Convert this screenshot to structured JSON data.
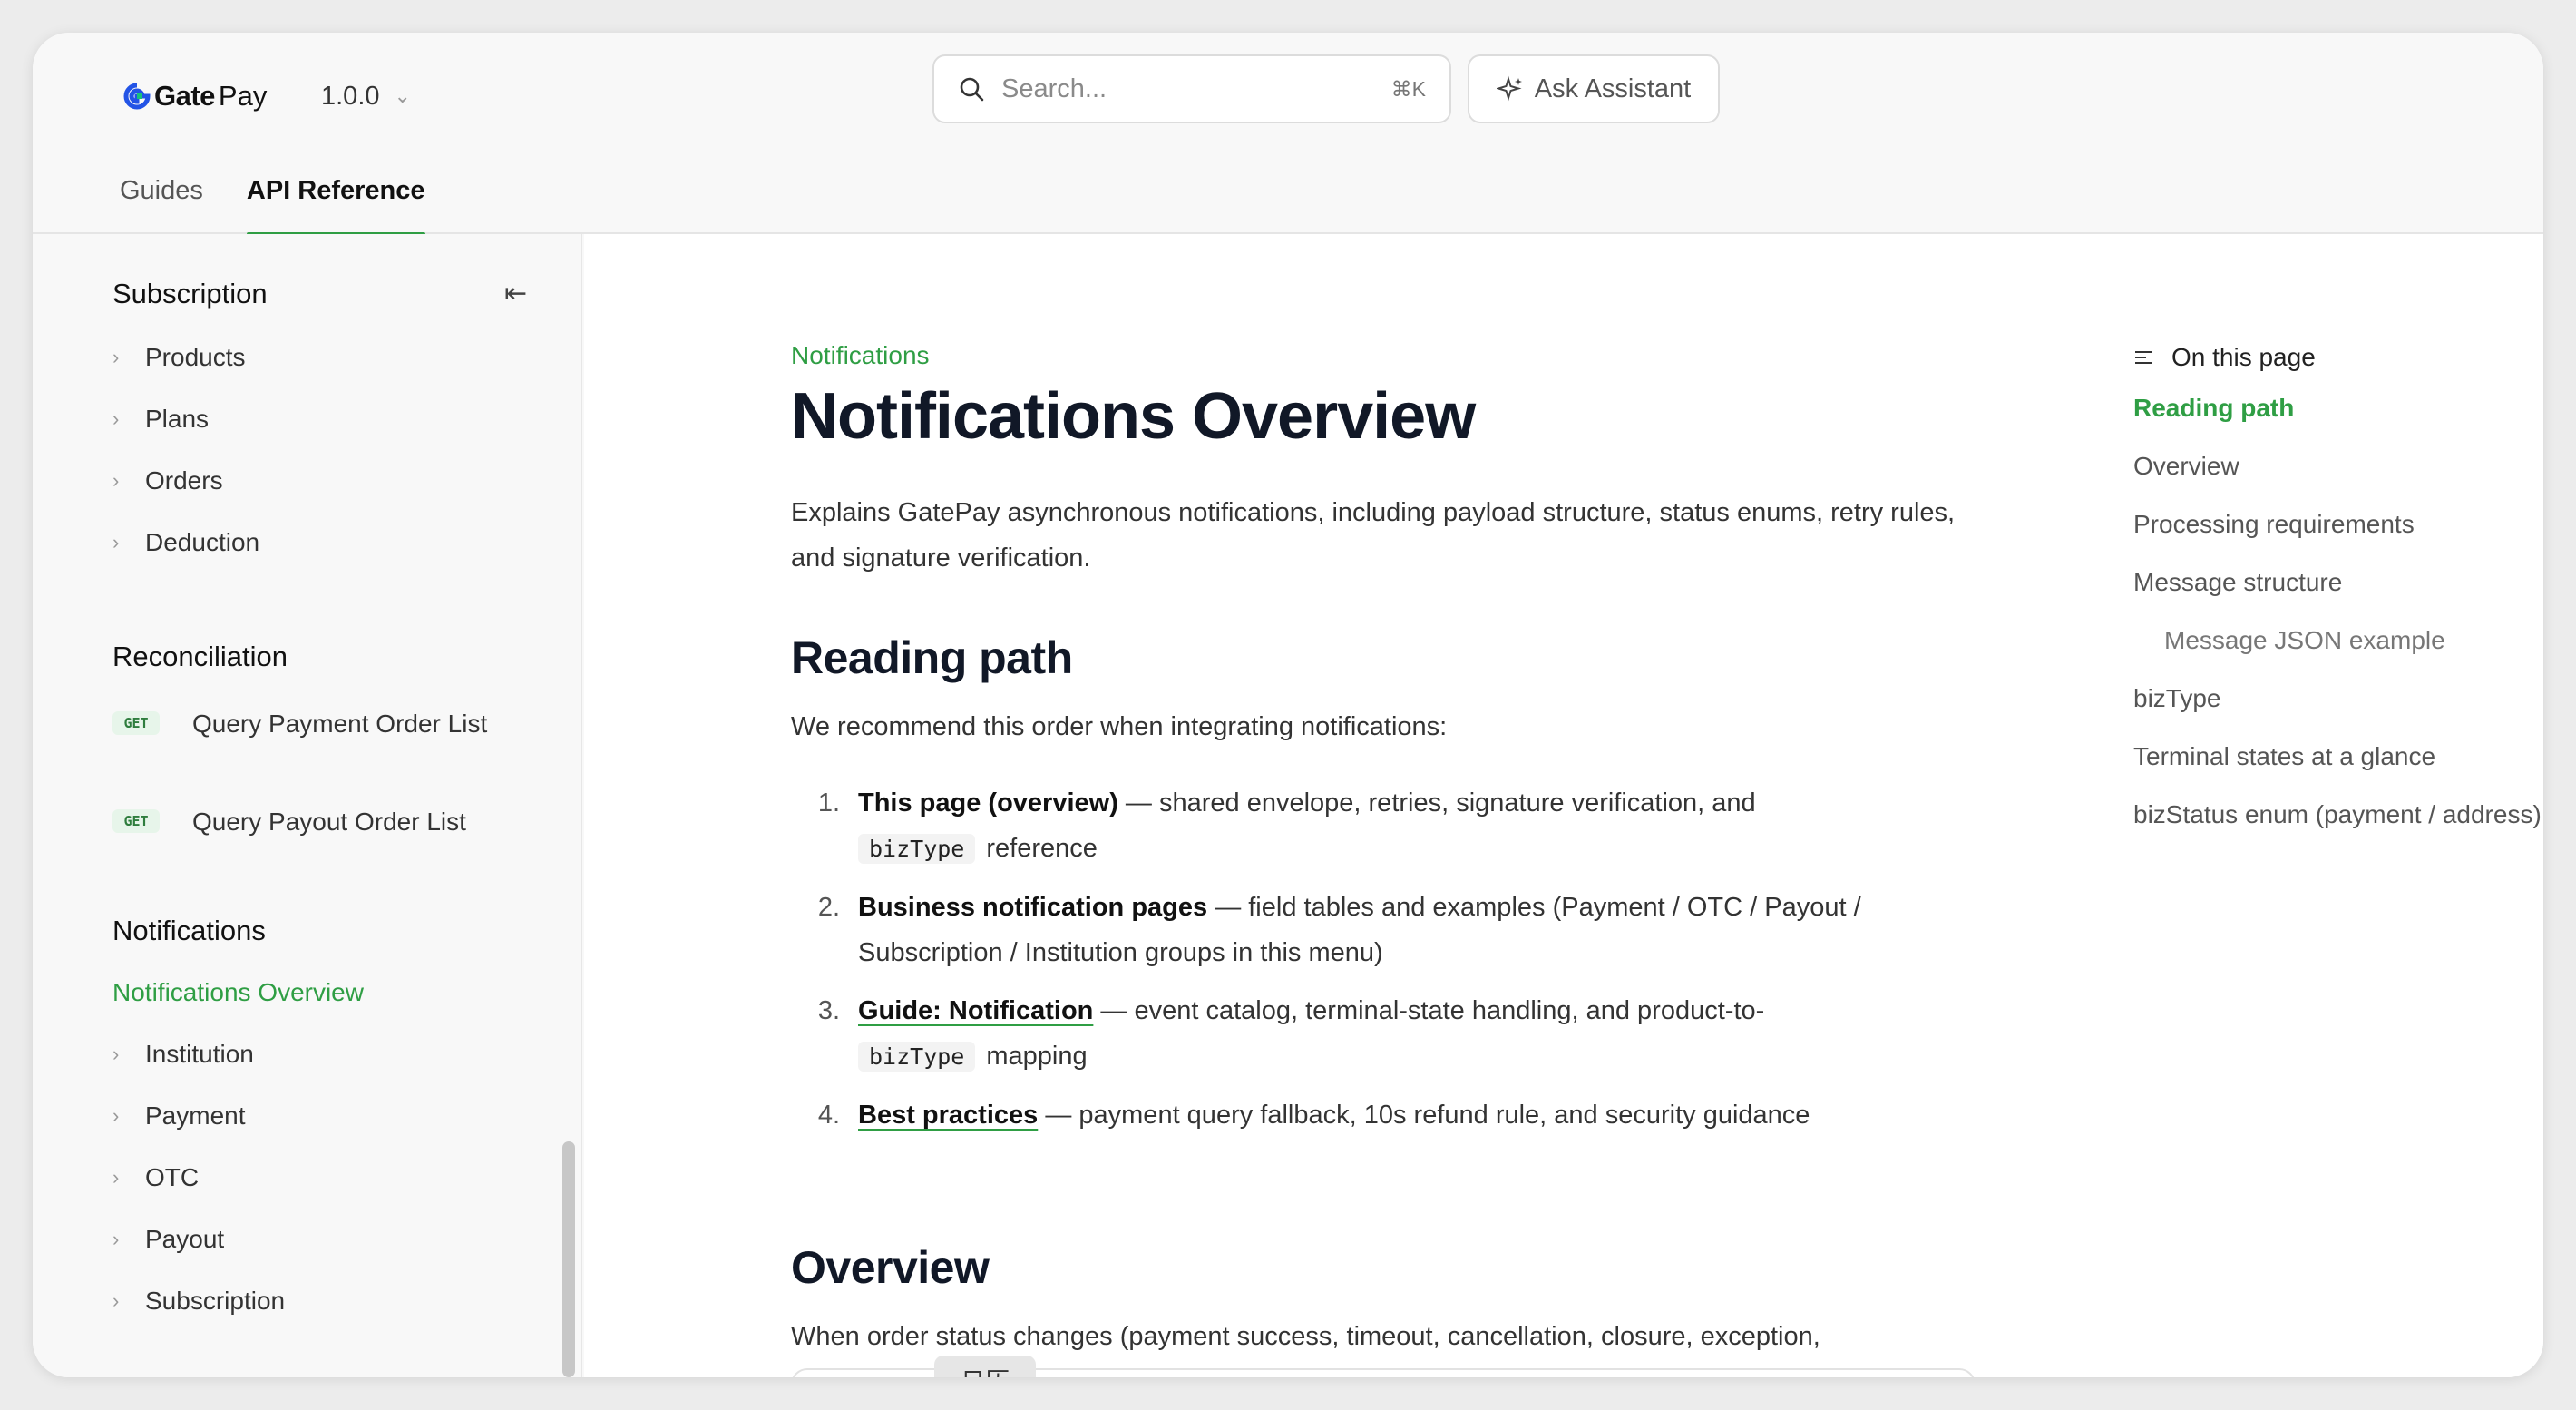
{
  "header": {
    "brand": {
      "bold": "Gate",
      "light": "Pay"
    },
    "version": "1.0.0",
    "search_placeholder": "Search...",
    "search_shortcut": "⌘K",
    "assistant_label": "Ask Assistant",
    "tabs": [
      {
        "label": "Guides",
        "active": false
      },
      {
        "label": "API Reference",
        "active": true
      }
    ]
  },
  "sidebar": {
    "sections": [
      {
        "title": "Subscription",
        "items": [
          "Products",
          "Plans",
          "Orders",
          "Deduction"
        ]
      },
      {
        "title": "Reconciliation",
        "items": [
          {
            "method": "GET",
            "label": "Query Payment Order List"
          },
          {
            "method": "GET",
            "label": "Query Payout Order List"
          }
        ]
      },
      {
        "title": "Notifications",
        "active_item": "Notifications Overview",
        "items": [
          "Institution",
          "Payment",
          "OTC",
          "Payout",
          "Subscription"
        ]
      }
    ]
  },
  "main": {
    "breadcrumb": "Notifications",
    "title": "Notifications Overview",
    "lead": "Explains GatePay asynchronous notifications, including payload structure, status enums, retry rules, and signature verification.",
    "reading_path": {
      "heading": "Reading path",
      "intro": "We recommend this order when integrating notifications:",
      "steps": [
        {
          "num": "1.",
          "strong": "This page (overview)",
          "text": " — shared envelope, retries, signature verification, and",
          "code": "bizType",
          "after": "reference"
        },
        {
          "num": "2.",
          "strong": "Business notification pages",
          "text": " — field tables and examples (Payment / OTC / Payout / Subscription / Institution groups in this menu)"
        },
        {
          "num": "3.",
          "link": "Guide: Notification",
          "text": " — event catalog, terminal-state handling, and product-to-",
          "code": "bizType",
          "after": "mapping"
        },
        {
          "num": "4.",
          "link": "Best practices",
          "text": " — payment query fallback, 10s refund rule, and security guidance"
        }
      ]
    },
    "overview": {
      "heading": "Overview",
      "text": "When order status changes (payment success, timeout, cancellation, closure, exception,"
    },
    "tooltip": "日历"
  },
  "toc": {
    "heading": "On this page",
    "items": [
      {
        "label": "Reading path",
        "active": true
      },
      {
        "label": "Overview"
      },
      {
        "label": "Processing requirements"
      },
      {
        "label": "Message structure"
      },
      {
        "label": "Message JSON example",
        "sub": true
      },
      {
        "label": "bizType"
      },
      {
        "label": "Terminal states at a glance"
      },
      {
        "label": "bizStatus enum (payment / address)"
      }
    ]
  },
  "colors": {
    "accent": "#2f9e44",
    "title": "#111827",
    "badge_bg": "#e7f5ea"
  }
}
